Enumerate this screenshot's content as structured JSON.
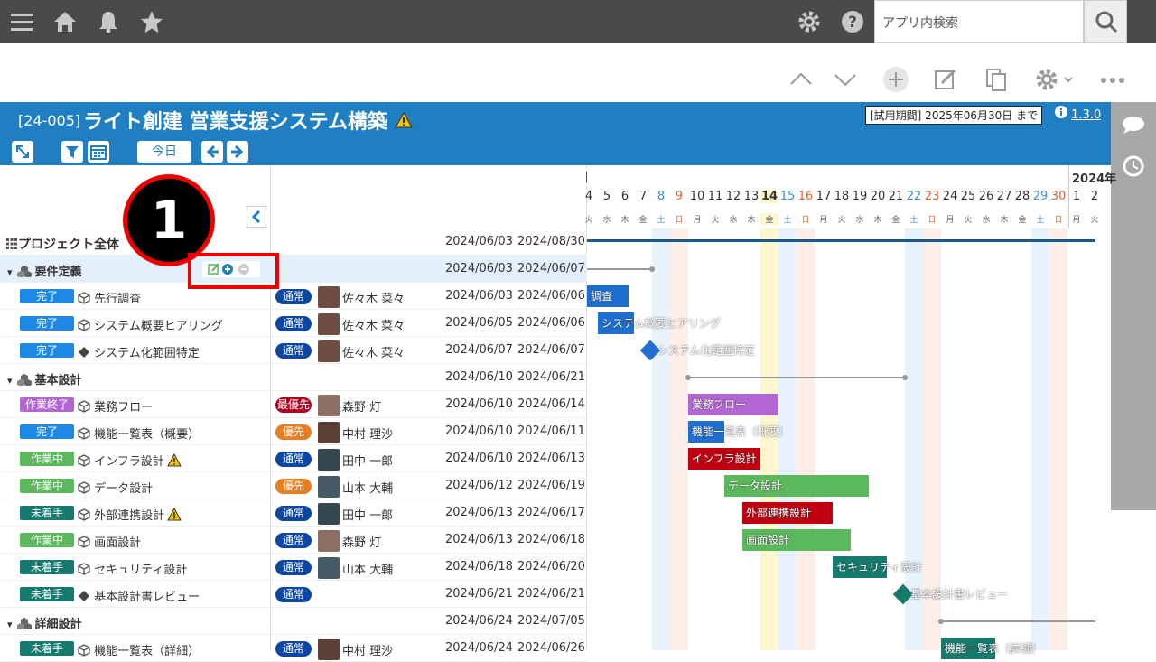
{
  "topbar": {
    "search_placeholder": "アプリ内検索",
    "icons": [
      "menu-icon",
      "home-icon",
      "bell-icon",
      "star-icon",
      "gear-icon",
      "help-icon",
      "search-icon"
    ]
  },
  "project": {
    "code": "[24-005]",
    "title": "ライト創建 営業支援システム構築",
    "trial": "[試用期間] 2025年06月30日 まで",
    "version": "1.3.0",
    "today_label": "今日"
  },
  "header": {
    "year_label": "2024年",
    "days": [
      "4",
      "5",
      "6",
      "7",
      "8",
      "9",
      "10",
      "11",
      "12",
      "13",
      "14",
      "15",
      "16",
      "17",
      "18",
      "19",
      "20",
      "21",
      "22",
      "23",
      "24",
      "25",
      "26",
      "27",
      "28",
      "29",
      "30",
      "1",
      "2"
    ],
    "dows": [
      "火",
      "水",
      "木",
      "金",
      "土",
      "日",
      "月",
      "火",
      "水",
      "木",
      "金",
      "土",
      "日",
      "月",
      "火",
      "水",
      "木",
      "金",
      "土",
      "日",
      "月",
      "火",
      "水",
      "木",
      "金",
      "土",
      "日",
      "月",
      "火"
    ]
  },
  "callout": "1",
  "rows": [
    {
      "type": "project",
      "label": "プロジェクト全体",
      "start": "2024/06/03",
      "end": "2024/08/30"
    },
    {
      "type": "group",
      "label": "要件定義",
      "start": "2024/06/03",
      "end": "2024/06/07"
    },
    {
      "type": "task",
      "status": "完了",
      "status_class": "st-done",
      "label": "先行調査",
      "prio": "通常",
      "prio_class": "p-normal",
      "person": "佐々木 菜々",
      "start": "2024/06/03",
      "end": "2024/06/06"
    },
    {
      "type": "task",
      "status": "完了",
      "status_class": "st-done",
      "label": "システム概要ヒアリング",
      "prio": "通常",
      "prio_class": "p-normal",
      "person": "佐々木 菜々",
      "start": "2024/06/05",
      "end": "2024/06/06"
    },
    {
      "type": "task",
      "status": "完了",
      "status_class": "st-done",
      "label": "システム化範囲特定",
      "prio": "通常",
      "prio_class": "p-normal",
      "person": "佐々木 菜々",
      "start": "2024/06/07",
      "end": "2024/06/07"
    },
    {
      "type": "group",
      "label": "基本設計",
      "start": "2024/06/10",
      "end": "2024/06/21"
    },
    {
      "type": "task",
      "status": "作業終了",
      "status_class": "st-fin",
      "label": "業務フロー",
      "prio": "最優先",
      "prio_class": "p-top",
      "person": "森野 灯",
      "start": "2024/06/10",
      "end": "2024/06/14"
    },
    {
      "type": "task",
      "status": "完了",
      "status_class": "st-done",
      "label": "機能一覧表（概要）",
      "prio": "優先",
      "prio_class": "p-high",
      "person": "中村 理沙",
      "start": "2024/06/10",
      "end": "2024/06/11"
    },
    {
      "type": "task",
      "status": "作業中",
      "status_class": "st-prog",
      "label": "インフラ設計",
      "prio": "通常",
      "prio_class": "p-normal",
      "person": "田中 一郎",
      "start": "2024/06/10",
      "end": "2024/06/13"
    },
    {
      "type": "task",
      "status": "作業中",
      "status_class": "st-prog",
      "label": "データ設計",
      "prio": "優先",
      "prio_class": "p-high",
      "person": "山本 大輔",
      "start": "2024/06/12",
      "end": "2024/06/19"
    },
    {
      "type": "task",
      "status": "未着手",
      "status_class": "st-not",
      "label": "外部連携設計",
      "prio": "通常",
      "prio_class": "p-normal",
      "person": "田中 一郎",
      "start": "2024/06/13",
      "end": "2024/06/17"
    },
    {
      "type": "task",
      "status": "作業中",
      "status_class": "st-prog",
      "label": "画面設計",
      "prio": "通常",
      "prio_class": "p-normal",
      "person": "森野 灯",
      "start": "2024/06/13",
      "end": "2024/06/18"
    },
    {
      "type": "task",
      "status": "未着手",
      "status_class": "st-not",
      "label": "セキュリティ設計",
      "prio": "通常",
      "prio_class": "p-normal",
      "person": "山本 大輔",
      "start": "2024/06/18",
      "end": "2024/06/20"
    },
    {
      "type": "task",
      "status": "未着手",
      "status_class": "st-not",
      "label": "基本設計書レビュー",
      "prio": "通常",
      "prio_class": "p-normal",
      "person": "",
      "start": "2024/06/21",
      "end": "2024/06/21"
    },
    {
      "type": "group",
      "label": "詳細設計",
      "start": "2024/06/24",
      "end": "2024/07/05"
    },
    {
      "type": "task",
      "status": "未着手",
      "status_class": "st-not",
      "label": "機能一覧表（詳細）",
      "prio": "通常",
      "prio_class": "p-normal",
      "person": "中村 理沙",
      "start": "2024/06/24",
      "end": "2024/06/26"
    }
  ],
  "bars": [
    {
      "label": "調査",
      "color": "#1e6fd0"
    },
    {
      "label": "システム概要ヒアリング",
      "color": "#1e6fd0"
    },
    {
      "label": "システム化範囲特定",
      "color": "#1e6fd0"
    },
    {
      "label": "業務フロー",
      "color": "#b266d4"
    },
    {
      "label": "機能一覧表（概要）",
      "color": "#1e6fd0"
    },
    {
      "label": "インフラ設計",
      "color": "#c00010"
    },
    {
      "label": "データ設計",
      "color": "#5cb85c"
    },
    {
      "label": "外部連携設計",
      "color": "#c00010"
    },
    {
      "label": "画面設計",
      "color": "#5cb85c"
    },
    {
      "label": "セキュリティ設計",
      "color": "#167a6e"
    },
    {
      "label": "基本設計書レビュー",
      "color": "#167a6e"
    },
    {
      "label": "機能一覧表（詳細）",
      "color": "#167a6e"
    }
  ]
}
